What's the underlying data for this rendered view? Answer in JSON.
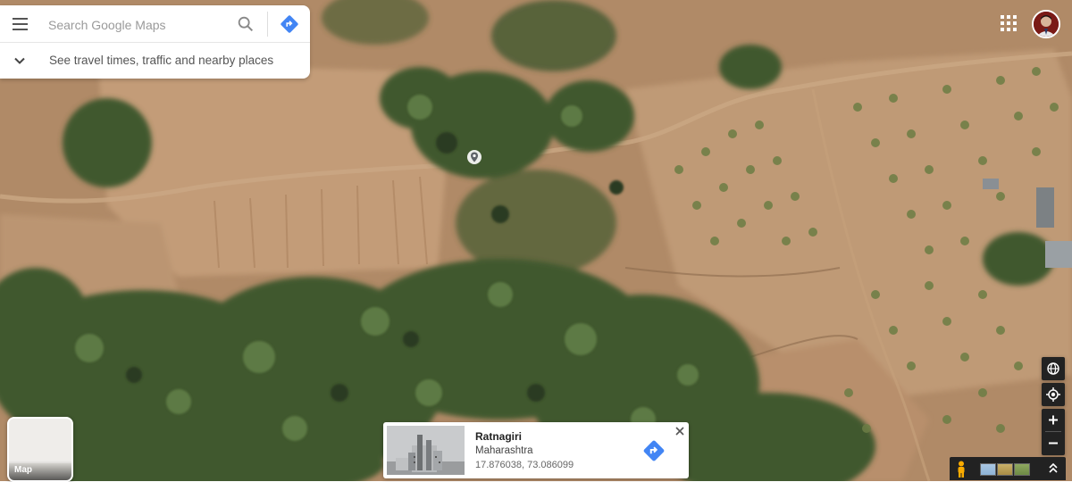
{
  "search": {
    "placeholder": "Search Google Maps",
    "hint": "See travel times, traffic and nearby places",
    "icons": [
      "menu-icon",
      "search-icon",
      "directions-icon",
      "chevron-down-icon"
    ]
  },
  "top_right": {
    "icons": [
      "apps-grid-icon",
      "avatar"
    ]
  },
  "layer_switch": {
    "label": "Map"
  },
  "place_card": {
    "name": "Ratnagiri",
    "region": "Maharashtra",
    "coords": "17.876038, 73.086099"
  },
  "controls": {
    "icons": [
      "globe-icon",
      "my-location-icon",
      "zoom-in-icon",
      "zoom-out-icon",
      "pegman-icon",
      "expand-icon"
    ]
  },
  "colors": {
    "accent_blue": "#4285f4",
    "soil": "#b08a67",
    "vegetation": "#3e5a2e"
  }
}
